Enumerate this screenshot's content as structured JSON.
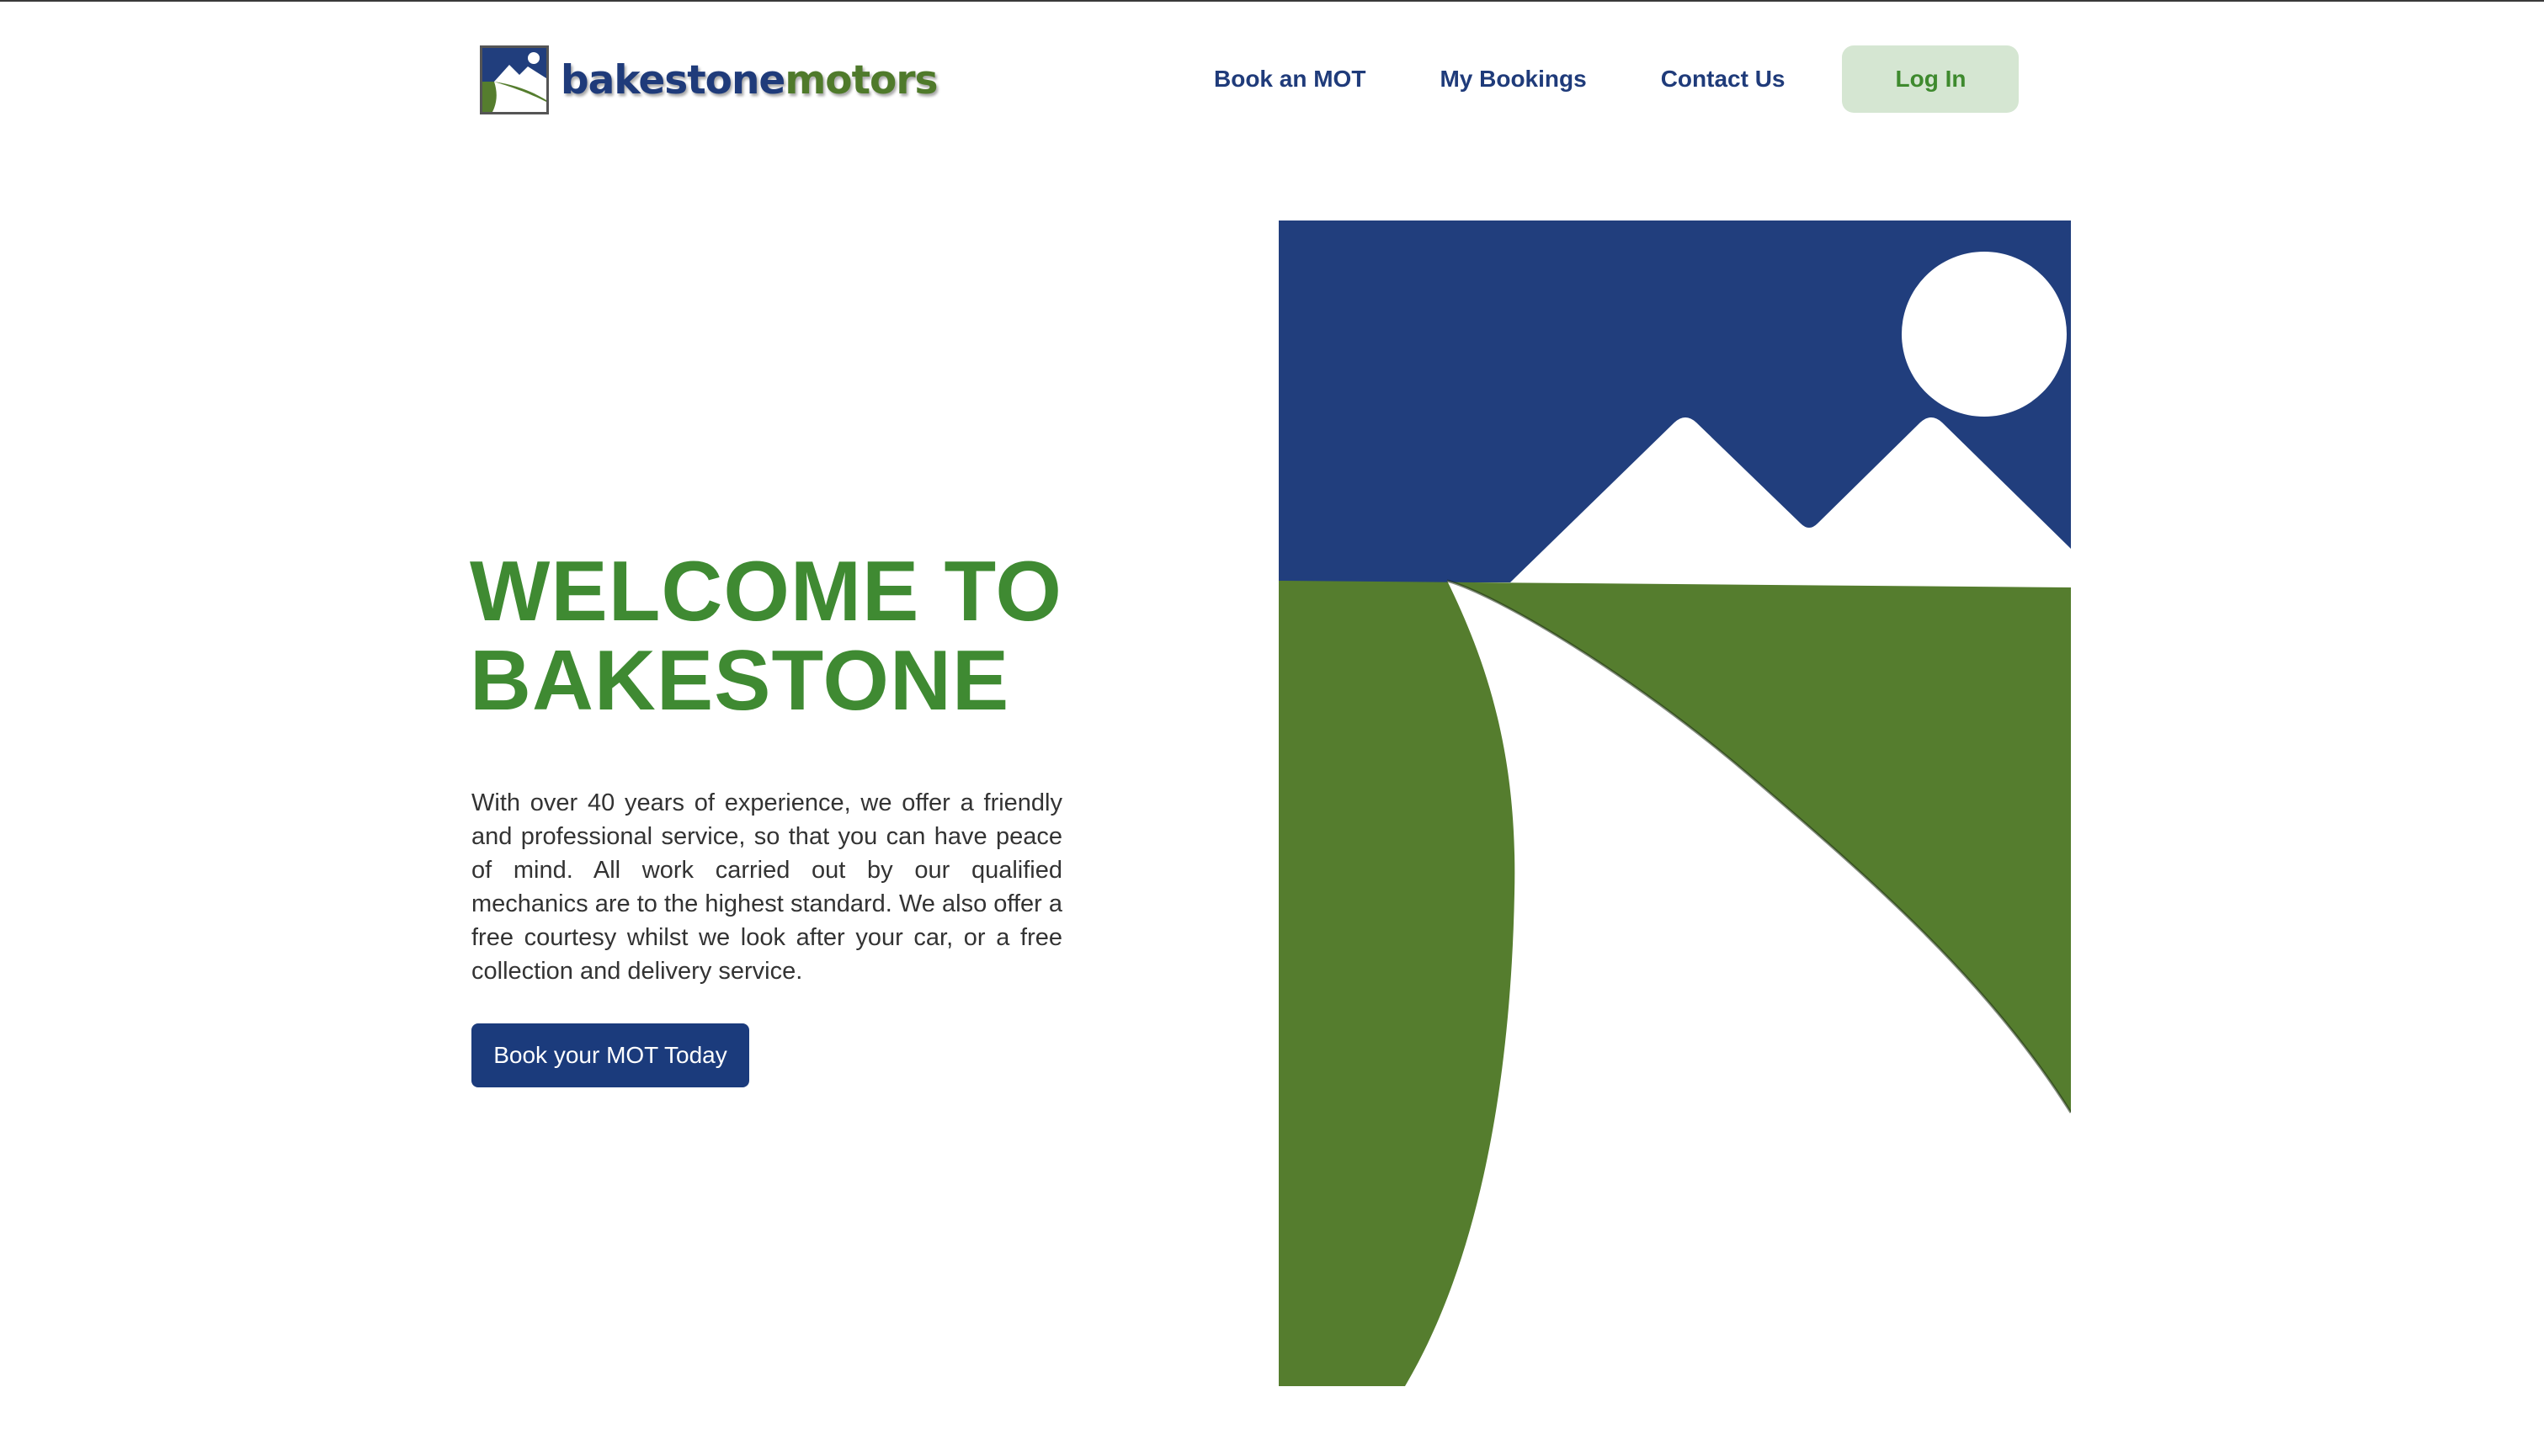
{
  "brand": {
    "name_part1": "bakestone",
    "name_part2": "motors",
    "primary_color": "#1f3b7a",
    "accent_color": "#4f7a2b"
  },
  "nav": {
    "items": [
      {
        "label": "Book an MOT"
      },
      {
        "label": "My Bookings"
      },
      {
        "label": "Contact Us"
      }
    ],
    "login_label": "Log In"
  },
  "hero": {
    "title_line1": "WELCOME TO",
    "title_line2": "BAKESTONE",
    "description": "With over 40 years of experience, we offer a friendly and professional service, so that you can have peace of mind. All work carried out by our qualified mechanics are to the highest standard. We also offer a free courtesy whilst we look after your car, or a free collection and delivery service.",
    "cta_label": "Book your MOT Today",
    "title_color": "#3f8a32",
    "cta_color": "#1b3b7c"
  },
  "illustration": {
    "icon": "landscape-logo-icon",
    "sky_color": "#213e7d",
    "grass_color": "#557d2e"
  }
}
